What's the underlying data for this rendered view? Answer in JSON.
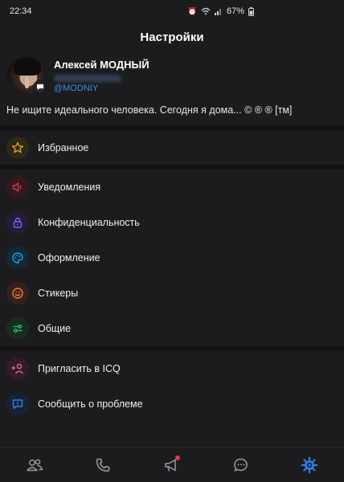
{
  "status_bar": {
    "time": "22:34",
    "battery": "67%"
  },
  "header": {
    "title": "Настройки"
  },
  "profile": {
    "name": "Алексей МОДНЫЙ",
    "username": "@MODNIY",
    "status": "Не ищите идеального человека. Сегодня я дома... © ® ® [тм]"
  },
  "menu": {
    "favorites": "Избранное",
    "notifications": "Уведомления",
    "privacy": "Конфиденциальность",
    "appearance": "Оформление",
    "stickers": "Стикеры",
    "general": "Общие",
    "invite": "Пригласить в ICQ",
    "report": "Сообщить о проблеме"
  },
  "colors": {
    "favorites": "#d9a520",
    "notifications": "#e0344b",
    "privacy": "#8a5cf5",
    "appearance": "#1ea0e8",
    "stickers": "#f07a3a",
    "general": "#2dbb6a",
    "invite": "#e0669c",
    "report": "#2f7de8",
    "active_tab": "#2f7de8"
  },
  "icons": {
    "favorites": "star-icon",
    "notifications": "speaker-icon",
    "privacy": "lock-icon",
    "appearance": "palette-icon",
    "stickers": "smile-icon",
    "general": "sliders-icon",
    "invite": "add-user-icon",
    "report": "report-icon"
  },
  "bottom_nav": [
    "contacts-icon",
    "phone-icon",
    "megaphone-icon",
    "chat-icon",
    "settings-gear-icon"
  ]
}
